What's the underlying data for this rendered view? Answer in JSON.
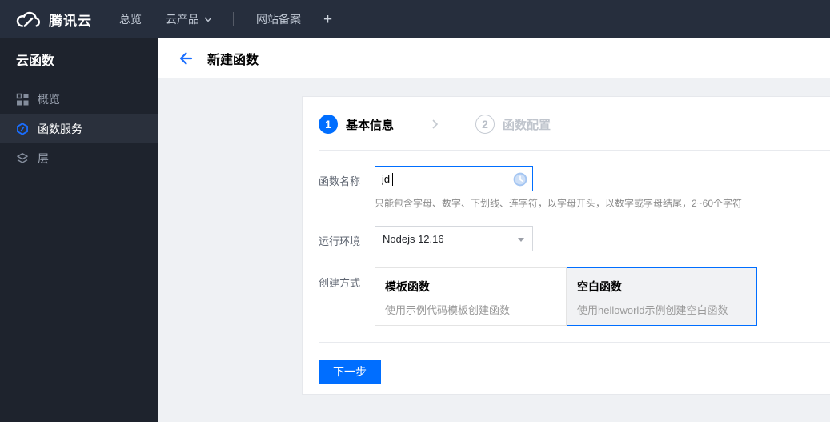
{
  "topnav": {
    "brand": "腾讯云",
    "overview_label": "总览",
    "products_label": "云产品",
    "beian_label": "网站备案",
    "plus_label": "+"
  },
  "sidebar": {
    "title": "云函数",
    "items": [
      {
        "label": "概览",
        "icon": "grid-icon",
        "active": false
      },
      {
        "label": "函数服务",
        "icon": "scf-hexagon-icon",
        "active": true
      },
      {
        "label": "层",
        "icon": "layers-icon",
        "active": false
      }
    ]
  },
  "header": {
    "title": "新建函数"
  },
  "wizard": {
    "steps": [
      {
        "number": "1",
        "label": "基本信息",
        "state": "active"
      },
      {
        "number": "2",
        "label": "函数配置",
        "state": "upcoming"
      }
    ]
  },
  "form": {
    "name_field": {
      "label": "函数名称",
      "value": "jd",
      "help": "只能包含字母、数字、下划线、连字符，以字母开头，以数字或字母结尾，2~60个字符"
    },
    "runtime_field": {
      "label": "运行环境",
      "value": "Nodejs 12.16"
    },
    "method_field": {
      "label": "创建方式",
      "options": [
        {
          "title": "模板函数",
          "desc": "使用示例代码模板创建函数",
          "selected": false
        },
        {
          "title": "空白函数",
          "desc": "使用helloworld示例创建空白函数",
          "selected": true
        }
      ]
    }
  },
  "actions": {
    "next_label": "下一步"
  },
  "icons": [
    "tencent-cloud-logo-icon",
    "chevron-down-icon",
    "grid-icon",
    "scf-hexagon-icon",
    "layers-icon",
    "arrow-left-icon",
    "chevron-right-icon",
    "clock-icon"
  ],
  "colors": {
    "accent": "#006eff",
    "topnav_bg": "#262e3d",
    "sidebar_bg": "#1e232d",
    "sidebar_active_bg": "#2a303c",
    "page_bg": "#eff1f4",
    "step_inactive": "#c0c5cd"
  }
}
